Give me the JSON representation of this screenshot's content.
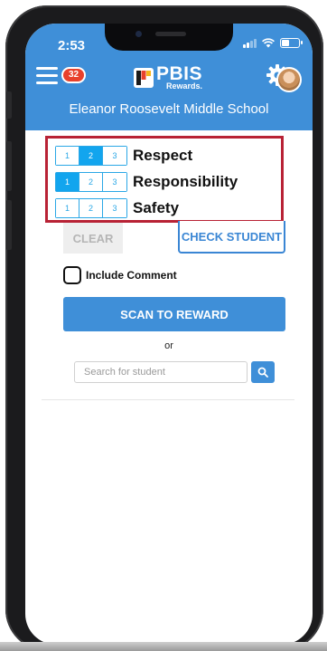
{
  "status_bar": {
    "time": "2:53",
    "battery_level": 0.45
  },
  "header": {
    "notification_count": "32",
    "logo_title": "PBIS",
    "logo_subtitle": "Rewards.",
    "school_name": "Eleanor Roosevelt Middle School",
    "brand_color": "#3f8fd8",
    "badge_color": "#e8412c"
  },
  "behaviors": [
    {
      "label": "Respect",
      "levels": [
        "1",
        "2",
        "3"
      ],
      "selected": "2"
    },
    {
      "label": "Responsibility",
      "levels": [
        "1",
        "2",
        "3"
      ],
      "selected": "1"
    },
    {
      "label": "Safety",
      "levels": [
        "1",
        "2",
        "3"
      ],
      "selected": ""
    }
  ],
  "highlight_color": "#b82235",
  "actions": {
    "clear_label": "CLEAR",
    "check_student_label": "CHECK STUDENT",
    "include_comment_label": "Include Comment",
    "scan_label": "SCAN TO REWARD",
    "or_text": "or"
  },
  "search": {
    "placeholder": "Search for student",
    "value": ""
  }
}
